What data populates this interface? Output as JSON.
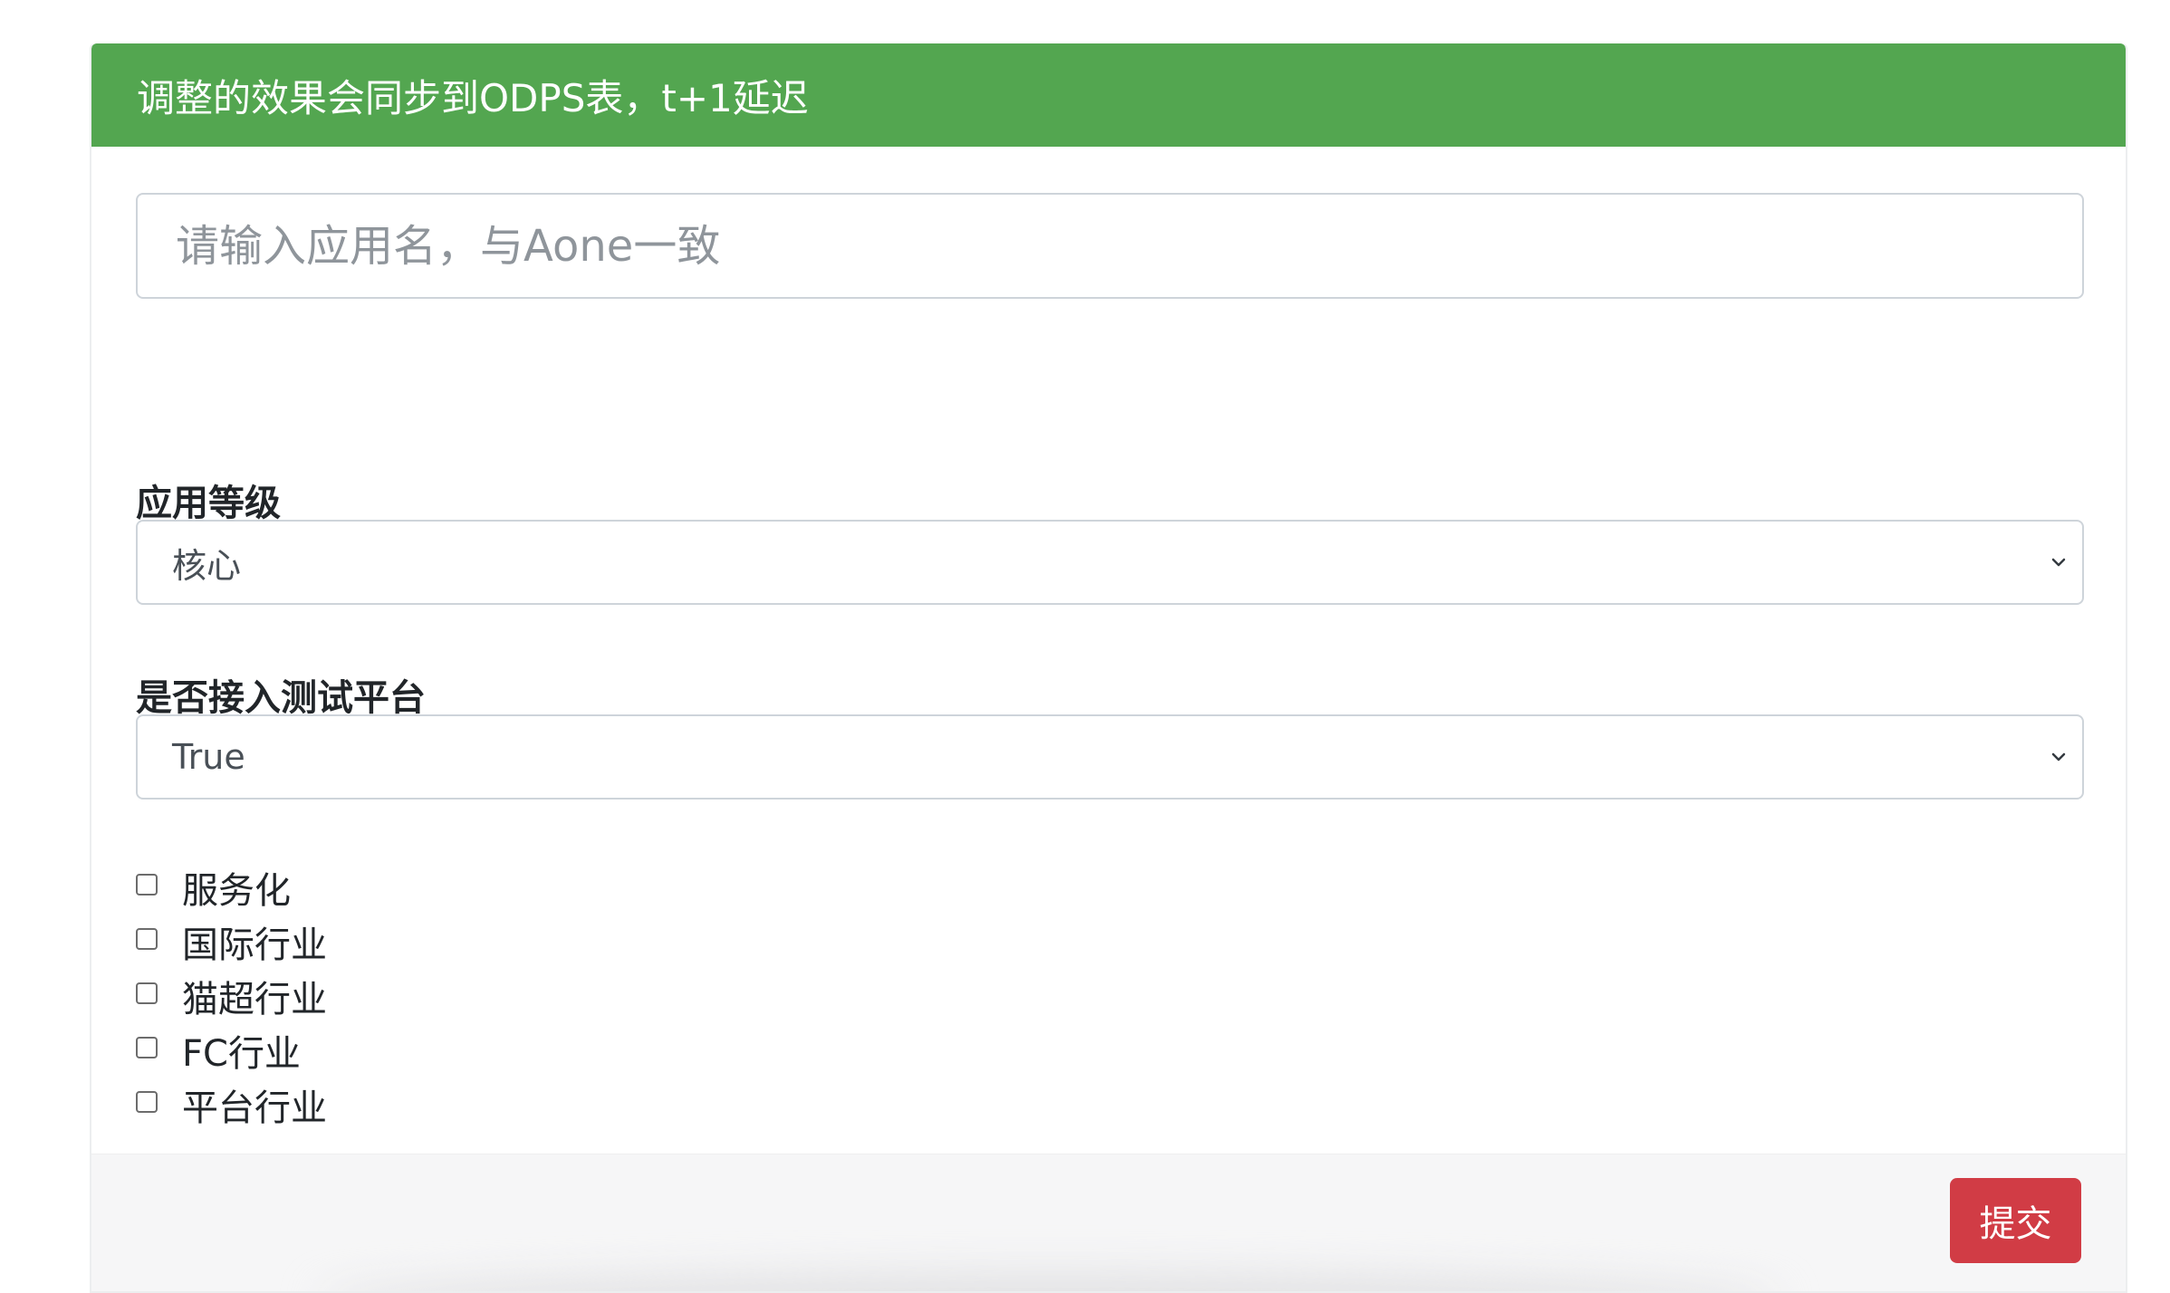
{
  "header": {
    "text": "调整的效果会同步到ODPS表，t+1延迟",
    "color": "#53a650"
  },
  "app_name_input": {
    "value": "",
    "placeholder": "请输入应用名，与Aone一致"
  },
  "app_level": {
    "label": "应用等级",
    "selected": "核心"
  },
  "test_platform": {
    "label": "是否接入测试平台",
    "selected": "True"
  },
  "checkboxes": [
    {
      "label": "服务化",
      "checked": false
    },
    {
      "label": "国际行业",
      "checked": false
    },
    {
      "label": "猫超行业",
      "checked": false
    },
    {
      "label": "FC行业",
      "checked": false
    },
    {
      "label": "平台行业",
      "checked": false
    }
  ],
  "submit": {
    "label": "提交",
    "color": "#d13c45"
  },
  "icons": {
    "select_arrow": "chevron-down-icon"
  }
}
